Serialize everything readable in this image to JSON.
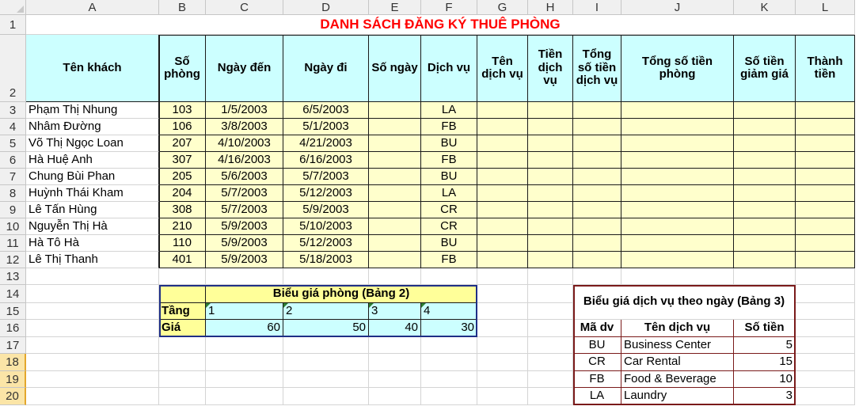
{
  "columns": [
    "A",
    "B",
    "C",
    "D",
    "E",
    "F",
    "G",
    "H",
    "I",
    "J",
    "K",
    "L"
  ],
  "rows": [
    "1",
    "2",
    "3",
    "4",
    "5",
    "6",
    "7",
    "8",
    "9",
    "10",
    "11",
    "12",
    "13",
    "14",
    "15",
    "16",
    "17",
    "18",
    "19",
    "20"
  ],
  "title": "DANH SÁCH ĐĂNG KÝ THUÊ PHÒNG",
  "headers": {
    "ten_khach": "Tên khách",
    "so_phong": "Số phòng",
    "ngay_den": "Ngày đến",
    "ngay_di": "Ngày đi",
    "so_ngay": "Số ngày",
    "dich_vu": "Dịch vụ",
    "ten_dich_vu": "Tên dịch vụ",
    "tien_dich_vu": "Tiền dịch vụ",
    "tong_tien_dich_vu": "Tổng số tiền dịch vụ",
    "tong_tien_phong": "Tổng số tiền phòng",
    "tien_giam_gia": "Số tiền giảm giá",
    "thanh_tien": "Thành tiền"
  },
  "bookings": [
    {
      "name": "Phạm Thị Nhung",
      "room": "103",
      "arrive": "1/5/2003",
      "leave": "6/5/2003",
      "service": "LA"
    },
    {
      "name": "Nhâm Đường",
      "room": "106",
      "arrive": "3/8/2003",
      "leave": "5/1/2003",
      "service": "FB"
    },
    {
      "name": "Võ Thị Ngọc Loan",
      "room": "207",
      "arrive": "4/10/2003",
      "leave": "4/21/2003",
      "service": "BU"
    },
    {
      "name": "Hà Huệ Anh",
      "room": "307",
      "arrive": "4/16/2003",
      "leave": "6/16/2003",
      "service": "FB"
    },
    {
      "name": "Chung Bùi Phan",
      "room": "205",
      "arrive": "5/6/2003",
      "leave": "5/7/2003",
      "service": "BU"
    },
    {
      "name": "Huỳnh Thái Kham",
      "room": "204",
      "arrive": "5/7/2003",
      "leave": "5/12/2003",
      "service": "LA"
    },
    {
      "name": "Lê Tấn Hùng",
      "room": "308",
      "arrive": "5/7/2003",
      "leave": "5/9/2003",
      "service": "CR"
    },
    {
      "name": "Nguyễn Thị Hà",
      "room": "210",
      "arrive": "5/9/2003",
      "leave": "5/10/2003",
      "service": "CR"
    },
    {
      "name": "Hà Tô Hà",
      "room": "110",
      "arrive": "5/9/2003",
      "leave": "5/12/2003",
      "service": "BU"
    },
    {
      "name": "Lê Thị Thanh",
      "room": "401",
      "arrive": "5/9/2003",
      "leave": "5/18/2003",
      "service": "FB"
    }
  ],
  "table2": {
    "title": "Biểu giá phòng (Bảng 2)",
    "floor_label": "Tầng",
    "price_label": "Giá",
    "floors": [
      "1",
      "2",
      "3",
      "4"
    ],
    "prices": [
      "60",
      "50",
      "40",
      "30"
    ]
  },
  "table3": {
    "title": "Biểu giá dịch vụ theo ngày (Bảng 3)",
    "col_code": "Mã dv",
    "col_name": "Tên dịch vụ",
    "col_amount": "Số tiền",
    "items": [
      {
        "code": "BU",
        "name": "Business Center",
        "amount": "5"
      },
      {
        "code": "CR",
        "name": "Car Rental",
        "amount": "15"
      },
      {
        "code": "FB",
        "name": "Food & Beverage",
        "amount": "10"
      },
      {
        "code": "LA",
        "name": "Laundry",
        "amount": "3"
      }
    ]
  }
}
